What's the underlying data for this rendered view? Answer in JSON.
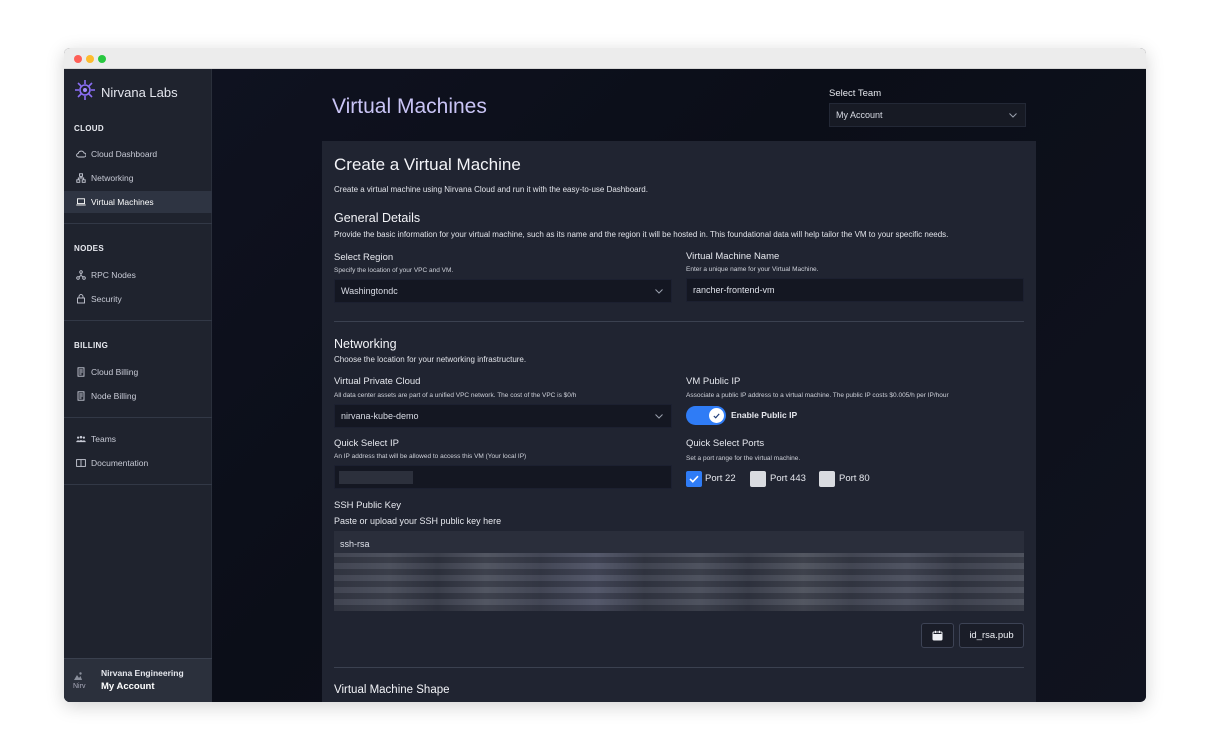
{
  "window": {
    "controls": [
      "close",
      "minimize",
      "maximize"
    ]
  },
  "sidebar": {
    "brand": "Nirvana Labs",
    "sections": [
      {
        "title": "CLOUD",
        "items": [
          {
            "label": "Cloud Dashboard",
            "icon": "cloud-icon"
          },
          {
            "label": "Networking",
            "icon": "network-icon"
          },
          {
            "label": "Virtual Machines",
            "icon": "laptop-icon",
            "active": true
          }
        ]
      },
      {
        "title": "NODES",
        "items": [
          {
            "label": "RPC Nodes",
            "icon": "nodes-icon"
          },
          {
            "label": "Security",
            "icon": "lock-icon"
          }
        ]
      },
      {
        "title": "BILLING",
        "items": [
          {
            "label": "Cloud Billing",
            "icon": "receipt-icon"
          },
          {
            "label": "Node Billing",
            "icon": "receipt-icon"
          }
        ]
      },
      {
        "title": "",
        "items": [
          {
            "label": "Teams",
            "icon": "users-icon"
          },
          {
            "label": "Documentation",
            "icon": "book-icon"
          }
        ]
      }
    ],
    "account": {
      "avatar_alt": "Nirv",
      "name": "Nirvana Engineering",
      "subtitle": "My Account"
    }
  },
  "header": {
    "title": "Virtual Machines",
    "team_label": "Select Team",
    "team_value": "My Account"
  },
  "form": {
    "title": "Create a Virtual Machine",
    "description": "Create a virtual machine using Nirvana Cloud and run it with the easy-to-use Dashboard.",
    "general": {
      "title": "General Details",
      "description": "Provide the basic information for your virtual machine, such as its name and the region it will be hosted in. This foundational data will help tailor the VM to your specific needs.",
      "region_label": "Select Region",
      "region_hint": "Specify the location of your VPC and VM.",
      "region_value": "Washingtondc",
      "name_label": "Virtual Machine Name",
      "name_hint": "Enter a unique name for your Virtual Machine.",
      "name_value": "rancher-frontend-vm"
    },
    "networking": {
      "title": "Networking",
      "description": "Choose the location for your networking infrastructure.",
      "vpc_label": "Virtual Private Cloud",
      "vpc_hint": "All data center assets are part of a unified VPC network. The cost of the VPC is $0/h",
      "vpc_value": "nirvana-kube-demo",
      "public_ip_label": "VM Public IP",
      "public_ip_hint": "Associate a public IP address to a virtual machine. The public IP costs $0.005/h per IP/hour",
      "public_ip_toggle_label": "Enable Public IP",
      "public_ip_enabled": true,
      "quick_ip_label": "Quick Select IP",
      "quick_ip_hint": "An IP address that will be allowed to access this VM (Your local IP)",
      "ports_label": "Quick Select Ports",
      "ports_hint": "Set a port range for the virtual machine.",
      "ports": [
        {
          "label": "Port 22",
          "checked": true
        },
        {
          "label": "Port 443",
          "checked": false
        },
        {
          "label": "Port 80",
          "checked": false
        }
      ]
    },
    "ssh": {
      "label": "SSH Public Key",
      "hint": "Paste or upload your SSH public key here",
      "value_prefix": "ssh-rsa",
      "upload_icon": "calendar-icon",
      "file_button": "id_rsa.pub"
    },
    "shape": {
      "title": "Virtual Machine Shape"
    }
  },
  "colors": {
    "accent": "#2f7cf6",
    "title": "#c9c4f5",
    "card": "#202431",
    "sidebar": "#1f232e"
  }
}
